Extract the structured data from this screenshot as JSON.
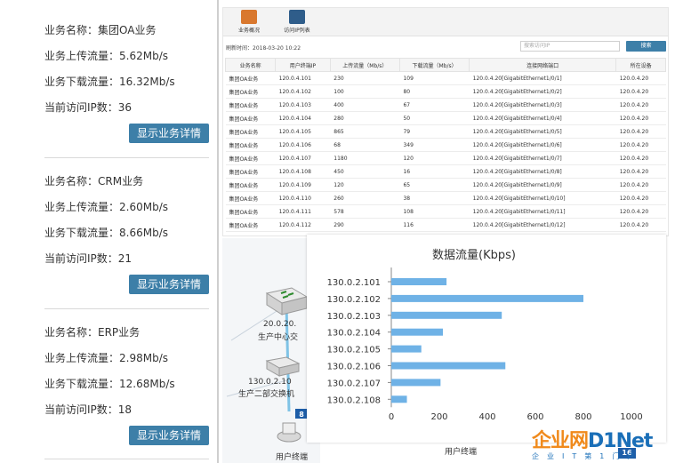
{
  "services": [
    {
      "name": "业务名称：集团OA业务",
      "upload": "业务上传流量：5.62Mb/s",
      "download": "业务下载流量：16.32Mb/s",
      "ips": "当前访问IP数：36",
      "button": "显示业务详情"
    },
    {
      "name": "业务名称：CRM业务",
      "upload": "业务上传流量：2.60Mb/s",
      "download": "业务下载流量：8.66Mb/s",
      "ips": "当前访问IP数：21",
      "button": "显示业务详情"
    },
    {
      "name": "业务名称：ERP业务",
      "upload": "业务上传流量：2.98Mb/s",
      "download": "业务下载流量：12.68Mb/s",
      "ips": "当前访问IP数：18",
      "button": "显示业务详情"
    }
  ],
  "toolbar": {
    "overview": "业务概况",
    "ip_list": "访问IP列表"
  },
  "refresh_time": "刷新时间：2018-03-20 10:22",
  "search": {
    "placeholder": "搜索访问IP",
    "button": "搜索"
  },
  "table": {
    "headers": [
      "业务名称",
      "用户终端IP",
      "上传流量（Mb/s）",
      "下载流量（Mb/s）",
      "连接网络端口",
      "所在设备"
    ],
    "rows": [
      [
        "集团OA业务",
        "120.0.4.101",
        "230",
        "109",
        "120.0.4.20[GigabitEthernet1/0/1]",
        "120.0.4.20"
      ],
      [
        "集团OA业务",
        "120.0.4.102",
        "100",
        "80",
        "120.0.4.20[GigabitEthernet1/0/2]",
        "120.0.4.20"
      ],
      [
        "集团OA业务",
        "120.0.4.103",
        "400",
        "67",
        "120.0.4.20[GigabitEthernet1/0/3]",
        "120.0.4.20"
      ],
      [
        "集团OA业务",
        "120.0.4.104",
        "280",
        "50",
        "120.0.4.20[GigabitEthernet1/0/4]",
        "120.0.4.20"
      ],
      [
        "集团OA业务",
        "120.0.4.105",
        "865",
        "79",
        "120.0.4.20[GigabitEthernet1/0/5]",
        "120.0.4.20"
      ],
      [
        "集团OA业务",
        "120.0.4.106",
        "68",
        "349",
        "120.0.4.20[GigabitEthernet1/0/6]",
        "120.0.4.20"
      ],
      [
        "集团OA业务",
        "120.0.4.107",
        "1180",
        "120",
        "120.0.4.20[GigabitEthernet1/0/7]",
        "120.0.4.20"
      ],
      [
        "集团OA业务",
        "120.0.4.108",
        "450",
        "16",
        "120.0.4.20[GigabitEthernet1/0/8]",
        "120.0.4.20"
      ],
      [
        "集团OA业务",
        "120.0.4.109",
        "120",
        "65",
        "120.0.4.20[GigabitEthernet1/0/9]",
        "120.0.4.20"
      ],
      [
        "集团OA业务",
        "120.0.4.110",
        "260",
        "38",
        "120.0.4.20[GigabitEthernet1/0/10]",
        "120.0.4.20"
      ],
      [
        "集团OA业务",
        "120.0.4.111",
        "578",
        "108",
        "120.0.4.20[GigabitEthernet1/0/11]",
        "120.0.4.20"
      ],
      [
        "集团OA业务",
        "120.0.4.112",
        "290",
        "116",
        "120.0.4.20[GigabitEthernet1/0/12]",
        "120.0.4.20"
      ]
    ]
  },
  "network": {
    "node1_ip": "20.0.20.",
    "node1_name": "生产中心交",
    "node2_ip": "130.0.2.10",
    "node2_name": "生产二部交换机",
    "terminal": "用户终端",
    "badge": "8"
  },
  "bottom_label": "用户终端",
  "badge16": "16",
  "logo": {
    "text1": "企业网",
    "text2": "D",
    "text3": "1Net",
    "sub": "企业IT第1门户"
  },
  "colors": {
    "button": "#3d7fa8",
    "bar": "#6fb2e6"
  },
  "chart_data": {
    "type": "bar",
    "orientation": "horizontal",
    "title": "数据流量(Kbps)",
    "categories": [
      "130.0.2.101",
      "130.0.2.102",
      "130.0.2.103",
      "130.0.2.104",
      "130.0.2.105",
      "130.0.2.106",
      "130.0.2.107",
      "130.0.2.108"
    ],
    "values": [
      230,
      800,
      460,
      215,
      125,
      475,
      205,
      65
    ],
    "xlim": [
      0,
      1000
    ],
    "xticks": [
      "0",
      "200",
      "400",
      "600",
      "800",
      "1000"
    ],
    "grid": false
  }
}
